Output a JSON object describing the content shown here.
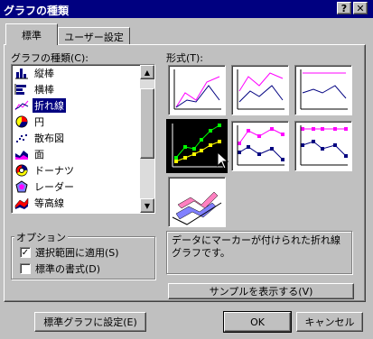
{
  "window": {
    "title": "グラフの種類"
  },
  "tabs": [
    {
      "label": "標準"
    },
    {
      "label": "ユーザー設定"
    }
  ],
  "chart_type_label": "グラフの種類(C):",
  "chart_types": [
    {
      "label": "縦棒",
      "icon": "column-chart-icon"
    },
    {
      "label": "横棒",
      "icon": "bar-chart-icon"
    },
    {
      "label": "折れ線",
      "icon": "line-chart-icon"
    },
    {
      "label": "円",
      "icon": "pie-chart-icon"
    },
    {
      "label": "散布図",
      "icon": "scatter-chart-icon"
    },
    {
      "label": "面",
      "icon": "area-chart-icon"
    },
    {
      "label": "ドーナツ",
      "icon": "doughnut-chart-icon"
    },
    {
      "label": "レーダー",
      "icon": "radar-chart-icon"
    },
    {
      "label": "等高線",
      "icon": "surface-chart-icon"
    }
  ],
  "selected_chart_type": "折れ線",
  "subtype_label": "形式(T):",
  "subtypes_selected_index": 3,
  "description": "データにマーカーが付けられた折れ線グラフです。",
  "options": {
    "title": "オプション",
    "apply_to_selection": {
      "label": "選択範囲に適用(S)",
      "checked": true
    },
    "default_format": {
      "label": "標準の書式(D)",
      "checked": false
    }
  },
  "buttons": {
    "preview": "サンプルを表示する(V)",
    "set_default": "標準グラフに設定(E)",
    "ok": "OK",
    "cancel": "キャンセル"
  },
  "colors": {
    "title_bar": "#000080",
    "face": "#c0c0c0",
    "selection": "#000080",
    "series1": "#ff00ff",
    "series2": "#000080"
  }
}
